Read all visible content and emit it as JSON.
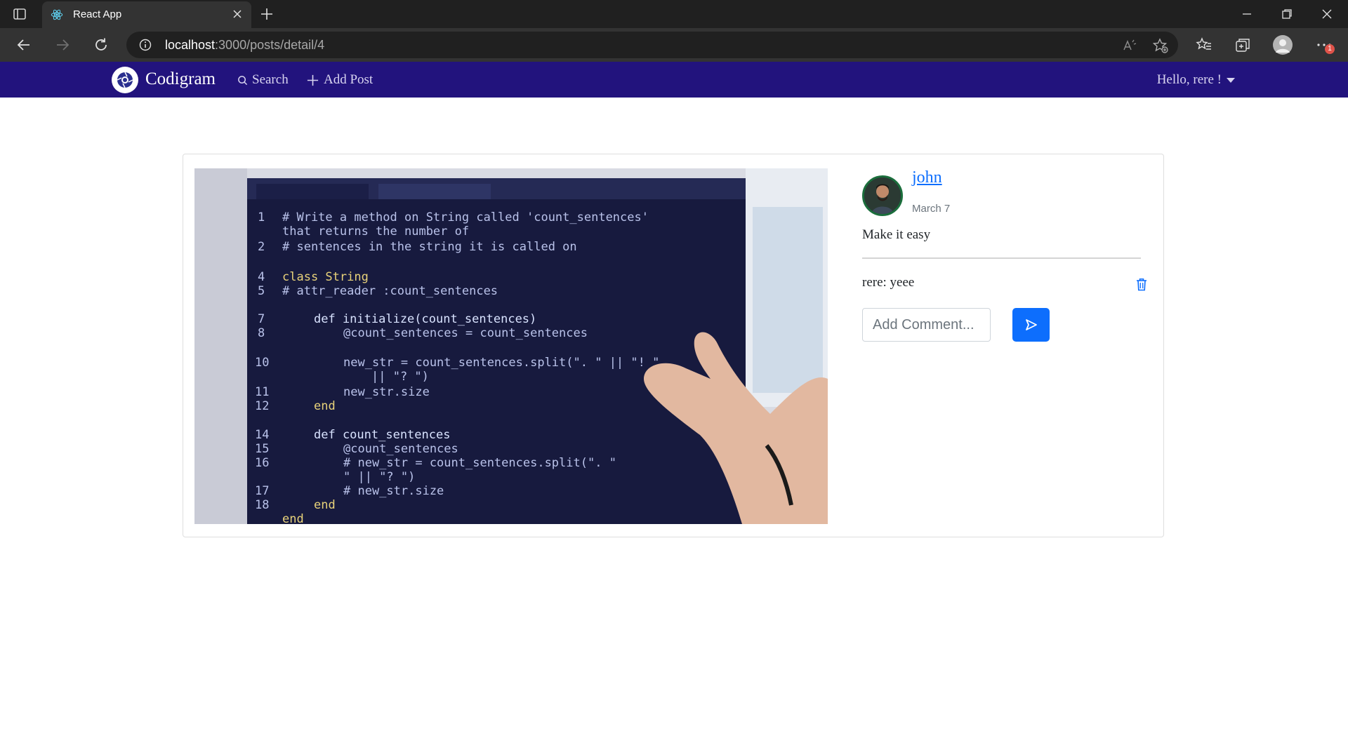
{
  "browser": {
    "tab_title": "React App",
    "url_host": "localhost",
    "url_path": ":3000/posts/detail/4",
    "notification_count": "1"
  },
  "navbar": {
    "brand": "Codigram",
    "search_label": "Search",
    "add_post_label": "Add Post",
    "greeting": "Hello, rere !"
  },
  "post": {
    "author": "john",
    "date": "March 7",
    "caption": "Make it easy",
    "image_alt": "Hand pointing at code on a screen"
  },
  "comments": [
    {
      "text": "rere: yeee"
    }
  ],
  "comment_form": {
    "placeholder": "Add Comment..."
  },
  "colors": {
    "navbar_bg": "#22137d",
    "primary": "#0d6efd"
  }
}
